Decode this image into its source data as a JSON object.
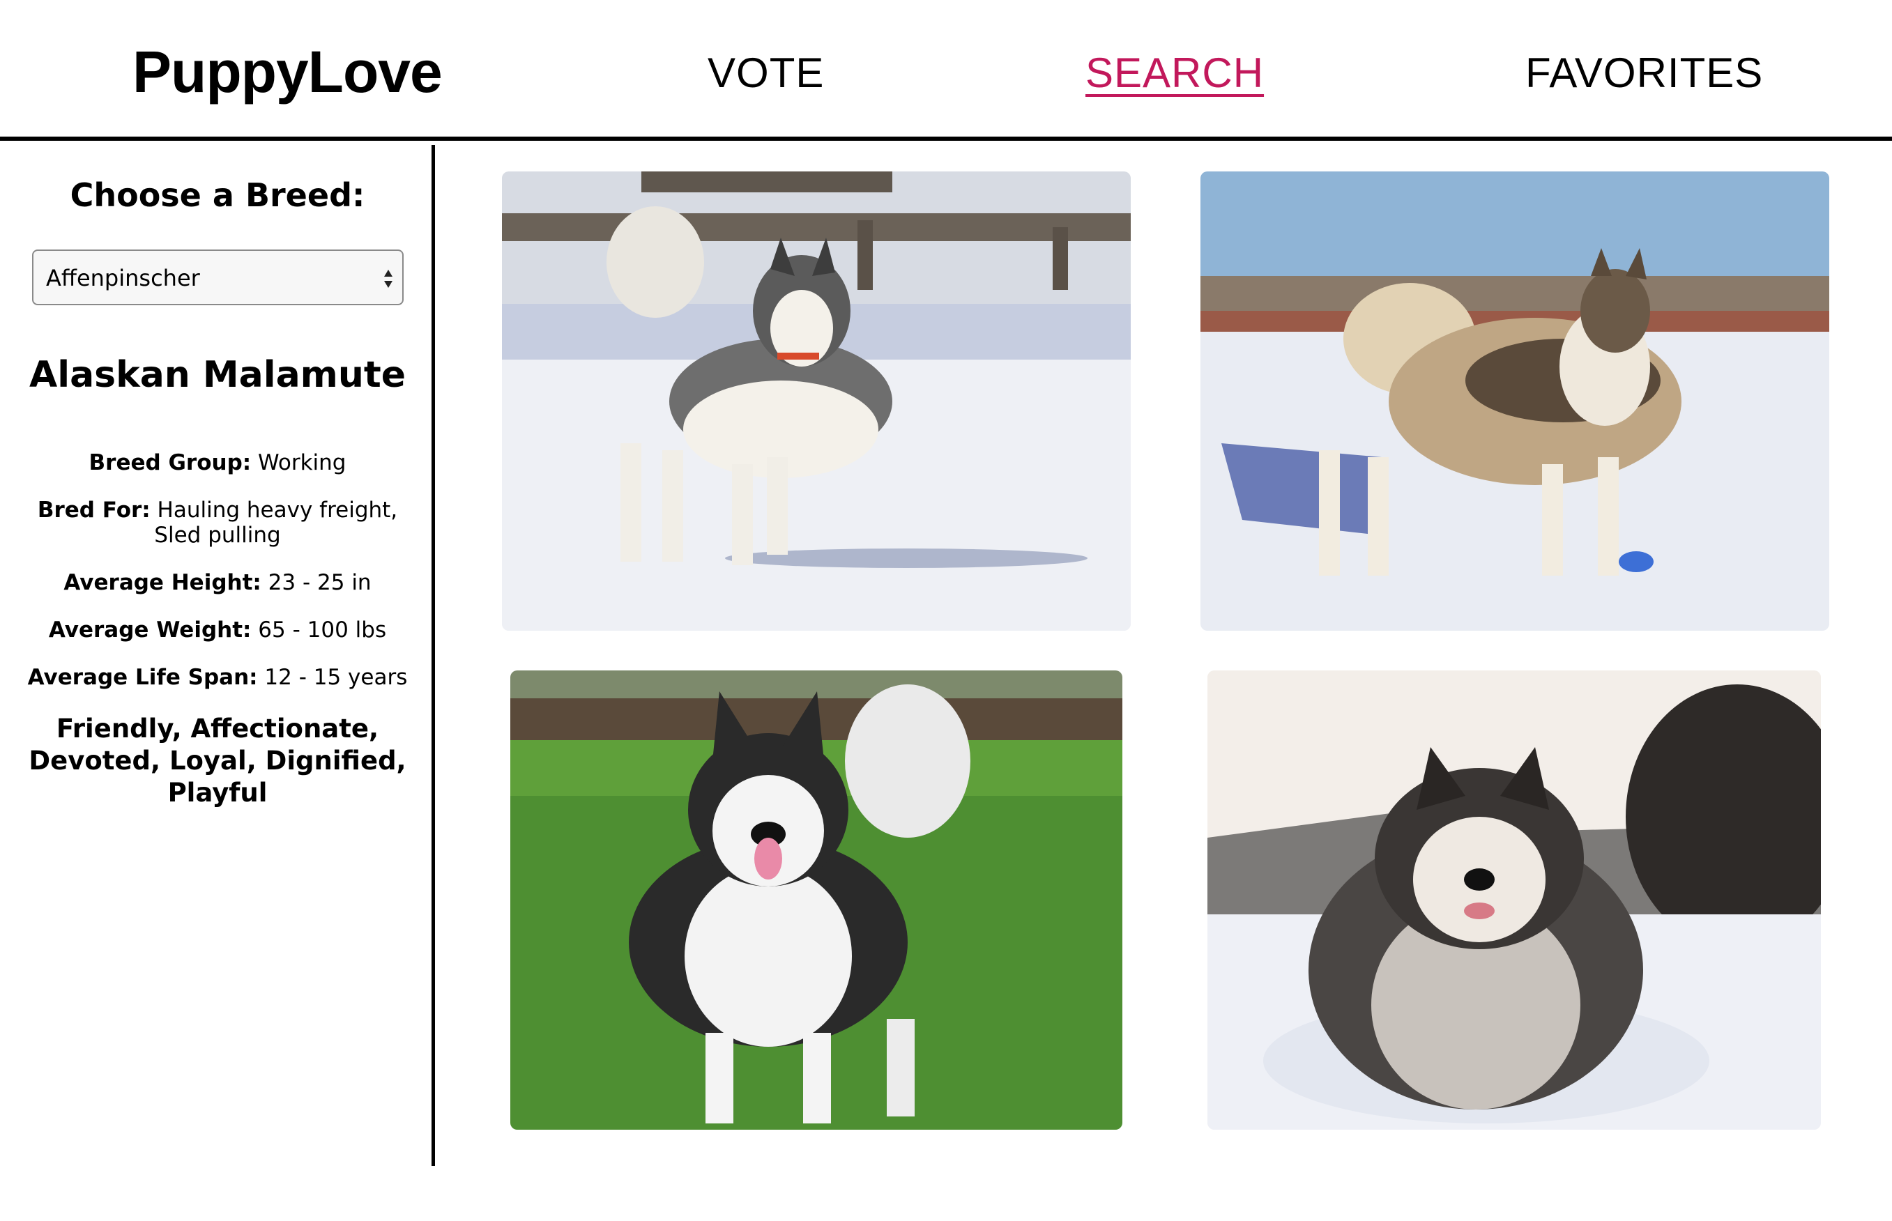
{
  "header": {
    "logo": "PuppyLove",
    "nav": [
      {
        "label": "VOTE",
        "active": false
      },
      {
        "label": "SEARCH",
        "active": true
      },
      {
        "label": "FAVORITES",
        "active": false
      }
    ],
    "active_color": "#c2185b"
  },
  "sidebar": {
    "choose_title": "Choose a Breed:",
    "select_value": "Affenpinscher",
    "breed_name": "Alaskan Malamute",
    "breed_group_label": "Breed Group:",
    "breed_group_value": "Working",
    "bred_for_label": "Bred For:",
    "bred_for_value": "Hauling heavy freight, Sled pulling",
    "height_label": "Average Height:",
    "height_value": "23 - 25 in",
    "weight_label": "Average Weight:",
    "weight_value": "65 - 100 lbs",
    "lifespan_label": "Average Life Span:",
    "lifespan_value": "12 - 15 years",
    "temperament": "Friendly, Affectionate, Devoted, Loyal, Dignified, Playful"
  },
  "photos": [
    {
      "icon": "dog-photo-snow-walking"
    },
    {
      "icon": "dog-photo-snow-standing"
    },
    {
      "icon": "dog-photo-grass"
    },
    {
      "icon": "dog-photo-snow-sitting"
    }
  ]
}
